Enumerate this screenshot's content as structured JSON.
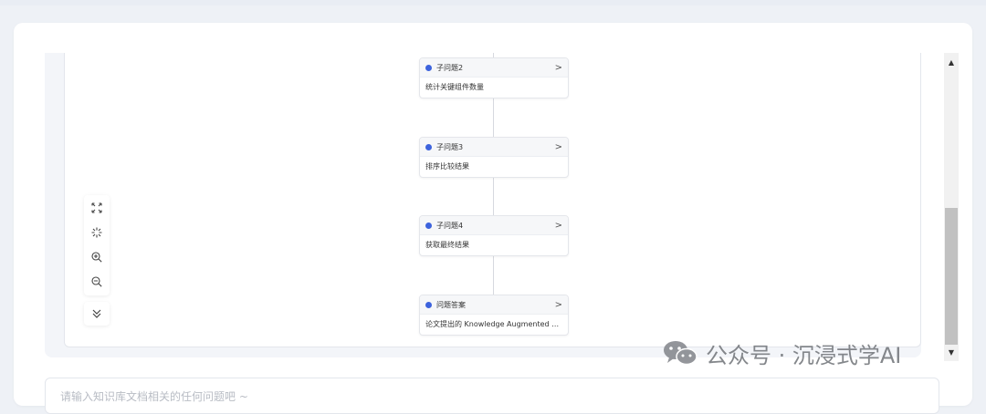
{
  "flow": {
    "nodes": [
      {
        "title": "子问题2",
        "content": "统计关键组件数量"
      },
      {
        "title": "子问题3",
        "content": "排序比较结果"
      },
      {
        "title": "子问题4",
        "content": "获取最终结果"
      },
      {
        "title": "问题答案",
        "content": "论文提出的 Knowledge Augmented Gener..."
      }
    ],
    "status_color": "#3d63dd"
  },
  "toolbar": {
    "icons": [
      "fullscreen-icon",
      "fit-view-icon",
      "zoom-in-icon",
      "zoom-out-icon"
    ],
    "collapse_icon": "double-chevron-down-icon"
  },
  "chat": {
    "placeholder": "请输入知识库文档相关的任何问题吧 ~"
  },
  "watermark": {
    "text": "公众号 · 沉浸式学AI"
  }
}
